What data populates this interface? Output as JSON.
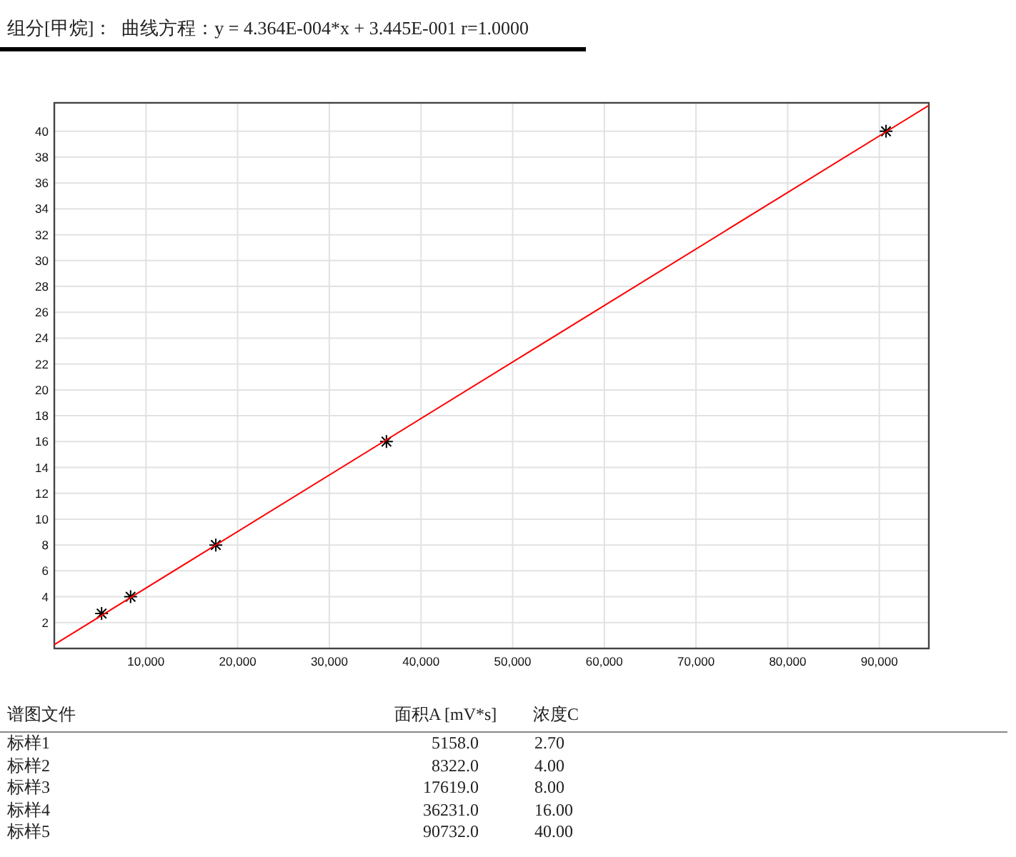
{
  "title": "组分[甲烷]：  曲线方程：y = 4.364E-004*x + 3.445E-001 r=1.0000",
  "calibration_chart": {
    "chart_data": {
      "type": "scatter",
      "grid": true,
      "xlim": [
        0,
        95400
      ],
      "ylim": [
        0,
        42.2
      ],
      "xticks": [
        {
          "value": 10000,
          "label": "10,000"
        },
        {
          "value": 20000,
          "label": "20,000"
        },
        {
          "value": 30000,
          "label": "30,000"
        },
        {
          "value": 40000,
          "label": "40,000"
        },
        {
          "value": 50000,
          "label": "50,000"
        },
        {
          "value": 60000,
          "label": "60,000"
        },
        {
          "value": 70000,
          "label": "70,000"
        },
        {
          "value": 80000,
          "label": "80,000"
        },
        {
          "value": 90000,
          "label": "90,000"
        }
      ],
      "yticks": [
        2,
        4,
        6,
        8,
        10,
        12,
        14,
        16,
        18,
        20,
        22,
        24,
        26,
        28,
        30,
        32,
        34,
        36,
        38,
        40
      ],
      "series": [
        {
          "color": "#000000",
          "x": [
            5158,
            8322,
            17619,
            36231,
            90732
          ],
          "values": [
            2.7,
            4,
            8,
            16,
            40
          ]
        },
        {
          "type": "line",
          "color": "#ff0000",
          "x": [
            0,
            95400
          ],
          "values": [
            0.3,
            42.0
          ]
        }
      ]
    }
  },
  "table": {
    "columns": [
      "谱图文件",
      "面积A [mV*s]",
      "浓度C"
    ],
    "rows": [
      [
        "标样1",
        "5158.0",
        "2.70"
      ],
      [
        "标样2",
        "8322.0",
        "4.00"
      ],
      [
        "标样3",
        "17619.0",
        "8.00"
      ],
      [
        "标样4",
        "36231.0",
        "16.00"
      ],
      [
        "标样5",
        "90732.0",
        "40.00"
      ]
    ]
  }
}
